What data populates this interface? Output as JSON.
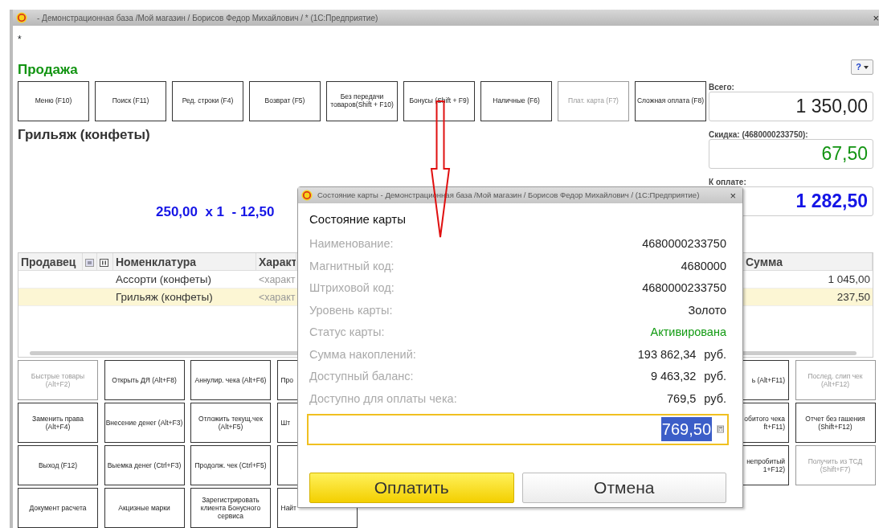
{
  "window": {
    "title": "- Демонстрационная база /Мой магазин / Борисов Федор Михайлович / *  (1С:Предприятие)",
    "close": "×",
    "marker": "*"
  },
  "form_title": "Продажа",
  "top_buttons": [
    {
      "label": "Меню (F10)",
      "disabled": false
    },
    {
      "label": "Поиск (F11)",
      "disabled": false
    },
    {
      "label": "Ред. строки (F4)",
      "disabled": false
    },
    {
      "label": "Возврат (F5)",
      "disabled": false
    },
    {
      "label": "Без передачи товаров(Shift + F10)",
      "disabled": false
    },
    {
      "label": "Бонусы (Shift + F9)",
      "disabled": false
    },
    {
      "label": "Наличные (F6)",
      "disabled": false
    },
    {
      "label": "Плат. карта (F7)",
      "disabled": true
    },
    {
      "label": "Сложная оплата (F8)",
      "disabled": false
    }
  ],
  "current_item": "Грильяж (конфеты)",
  "price_line": "250,00  x 1  - 12,50",
  "help_button": {
    "label": "?"
  },
  "totals": [
    {
      "label": "Всего:",
      "value": "1 350,00",
      "kind": "total"
    },
    {
      "label": "Скидка: (4680000233750):",
      "value": "67,50",
      "kind": "discount"
    },
    {
      "label": "К оплате:",
      "value": "1 282,50",
      "kind": "due"
    }
  ],
  "table": {
    "columns": [
      {
        "label": "Продавец",
        "kind": "text"
      },
      {
        "kind": "number-icon"
      },
      {
        "kind": "barcode-icon"
      },
      {
        "label": "Номенклатура",
        "kind": "text"
      },
      {
        "label": "Характ",
        "kind": "text"
      },
      {
        "label": "Сумма",
        "kind": "amount"
      }
    ],
    "rows": [
      {
        "selected": false,
        "nomenclature": "Ассорти (конфеты)",
        "characteristic": "<характ",
        "amount": "1 045,00"
      },
      {
        "selected": true,
        "nomenclature": "Грильяж (конфеты)",
        "characteristic": "<характ",
        "amount": "237,50"
      }
    ]
  },
  "grid_rows": [
    {
      "left": [
        {
          "label": "Быстрые товары (Alt+F2)",
          "disabled": true
        },
        {
          "label": "Открыть ДЯ (Alt+F8)",
          "disabled": false
        },
        {
          "label": "Аннулир. чека (Alt+F6)",
          "disabled": false
        },
        {
          "label": "Про",
          "disabled": false
        }
      ],
      "right": [
        {
          "label": "ь (Alt+F11)",
          "disabled": false
        },
        {
          "label": "Послед. слип чек (Alt+F12)",
          "disabled": true
        }
      ]
    },
    {
      "left": [
        {
          "label": "Заменить права (Alt+F4)",
          "disabled": false
        },
        {
          "label": "Внесение денег (Alt+F3)",
          "disabled": false
        },
        {
          "label": "Отложить текущ.чек (Alt+F5)",
          "disabled": false
        },
        {
          "label": "Шт",
          "disabled": false
        }
      ],
      "right": [
        {
          "label": "обитого чека\nft+F11)",
          "disabled": false
        },
        {
          "label": "Отчет без гашения (Shift+F12)",
          "disabled": false
        }
      ]
    },
    {
      "left": [
        {
          "label": "Выход (F12)",
          "disabled": false
        },
        {
          "label": "Выемка денег (Ctrl+F3)",
          "disabled": false
        },
        {
          "label": "Продолж. чек (Ctrl+F5)",
          "disabled": false
        },
        {
          "disabled": false
        }
      ],
      "right": [
        {
          "label": "непробитый\n1+F12)",
          "disabled": false
        },
        {
          "label": "Получить из ТСД (Shift+F7)",
          "disabled": true
        }
      ]
    },
    {
      "left": [
        {
          "label": "Документ расчета",
          "disabled": false
        },
        {
          "label": "Акцизные марки",
          "disabled": false
        },
        {
          "label": "Зарегистрировать клиента Бонусного сервиса",
          "disabled": false
        },
        {
          "label": "Найт",
          "disabled": false
        }
      ]
    }
  ],
  "dialog": {
    "title": "Состояние карты - Демонстрационная база /Мой магазин / Борисов Федор Михайлович /  (1С:Предприятие)",
    "close": "×",
    "heading": "Состояние карты",
    "fields": [
      {
        "label": "Наименование:",
        "value": "4680000233750",
        "kind": "plain"
      },
      {
        "label": "Магнитный код:",
        "value": "4680000",
        "kind": "plain"
      },
      {
        "label": "Штриховой код:",
        "value": "4680000233750",
        "kind": "plain"
      },
      {
        "label": "Уровень карты:",
        "value": "Золото",
        "kind": "plain"
      },
      {
        "label": "Статус карты:",
        "value": "Активирована",
        "kind": "status"
      },
      {
        "label": "Сумма накоплений:",
        "value": "193 862,34",
        "unit": "руб.",
        "kind": "money"
      },
      {
        "label": "Доступный баланс:",
        "value": "9 463,32",
        "unit": "руб.",
        "kind": "money"
      },
      {
        "label": "Доступно для оплаты чека:",
        "value": "769,5",
        "unit": "руб.",
        "kind": "money"
      }
    ],
    "amount_input": {
      "value": "769,50",
      "selected": true
    },
    "buttons": [
      {
        "label": "Оплатить",
        "kind": "primary"
      },
      {
        "label": "Отмена",
        "kind": "secondary"
      }
    ]
  }
}
